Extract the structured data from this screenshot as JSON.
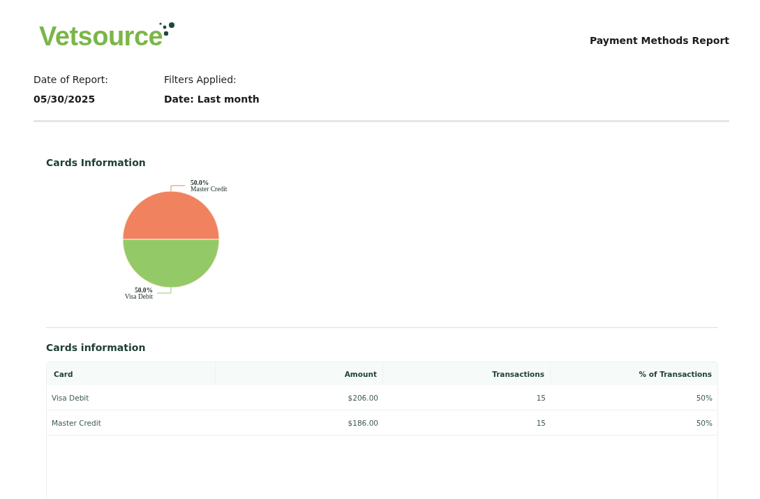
{
  "header": {
    "logo": "Vetsource",
    "report_title": "Payment Methods Report"
  },
  "meta": [
    {
      "label": "Date of Report:",
      "value": "05/30/2025"
    },
    {
      "label": "Filters Applied:",
      "value": "Date: Last month"
    }
  ],
  "chart_section": {
    "title": "Cards Information",
    "chart_data": {
      "type": "pie",
      "categories": [
        "Master Credit",
        "Visa Debit"
      ],
      "values": [
        50,
        50
      ],
      "colors": [
        "#f0825f",
        "#94c967"
      ],
      "value_labels": [
        "50.0%",
        "50.0%"
      ]
    }
  },
  "table_section": {
    "title": "Cards information",
    "columns": [
      "Card",
      "Amount",
      "Transactions",
      "% of Transactions"
    ],
    "rows": [
      [
        "Visa Debit",
        "$206.00",
        "15",
        "50%"
      ],
      [
        "Master Credit",
        "$186.00",
        "15",
        "50%"
      ]
    ]
  }
}
